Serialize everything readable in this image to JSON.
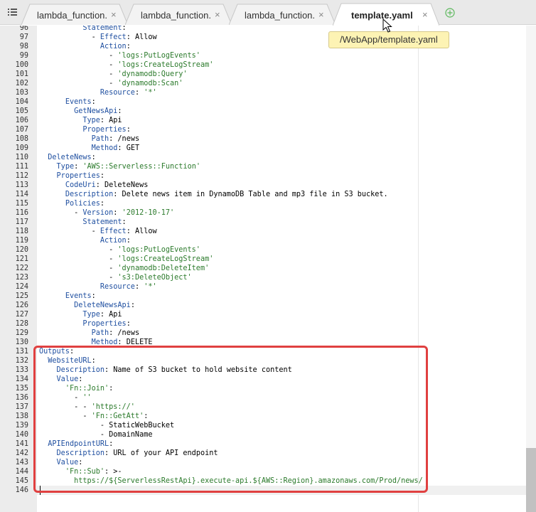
{
  "tabs": [
    {
      "label": "lambda_function.",
      "active": false
    },
    {
      "label": "lambda_function.",
      "active": false
    },
    {
      "label": "lambda_function.",
      "active": false
    },
    {
      "label": "template.yaml",
      "active": true
    }
  ],
  "tooltip": "/WebApp/template.yaml",
  "close_glyph": "×",
  "icons": {
    "menu": "tab-menu-icon",
    "add": "add-tab-icon",
    "pointer": "mouse-pointer-icon"
  },
  "editor": {
    "first_line_number": 96,
    "highlighted_lines": {
      "from": 131,
      "to": 145
    },
    "current_line": 146,
    "lines": [
      [
        [
          "p",
          "          "
        ],
        [
          "k",
          "Statement"
        ],
        [
          "p",
          ":"
        ]
      ],
      [
        [
          "p",
          "            - "
        ],
        [
          "k",
          "Effect"
        ],
        [
          "p",
          ": Allow"
        ]
      ],
      [
        [
          "p",
          "              "
        ],
        [
          "k",
          "Action"
        ],
        [
          "p",
          ":"
        ]
      ],
      [
        [
          "p",
          "                - "
        ],
        [
          "s",
          "'logs:PutLogEvents'"
        ]
      ],
      [
        [
          "p",
          "                - "
        ],
        [
          "s",
          "'logs:CreateLogStream'"
        ]
      ],
      [
        [
          "p",
          "                - "
        ],
        [
          "s",
          "'dynamodb:Query'"
        ]
      ],
      [
        [
          "p",
          "                - "
        ],
        [
          "s",
          "'dynamodb:Scan'"
        ]
      ],
      [
        [
          "p",
          "              "
        ],
        [
          "k",
          "Resource"
        ],
        [
          "p",
          ": "
        ],
        [
          "s",
          "'*'"
        ]
      ],
      [
        [
          "p",
          "      "
        ],
        [
          "k",
          "Events"
        ],
        [
          "p",
          ":"
        ]
      ],
      [
        [
          "p",
          "        "
        ],
        [
          "k",
          "GetNewsApi"
        ],
        [
          "p",
          ":"
        ]
      ],
      [
        [
          "p",
          "          "
        ],
        [
          "k",
          "Type"
        ],
        [
          "p",
          ": Api"
        ]
      ],
      [
        [
          "p",
          "          "
        ],
        [
          "k",
          "Properties"
        ],
        [
          "p",
          ":"
        ]
      ],
      [
        [
          "p",
          "            "
        ],
        [
          "k",
          "Path"
        ],
        [
          "p",
          ": /news"
        ]
      ],
      [
        [
          "p",
          "            "
        ],
        [
          "k",
          "Method"
        ],
        [
          "p",
          ": GET"
        ]
      ],
      [
        [
          "p",
          "  "
        ],
        [
          "k",
          "DeleteNews"
        ],
        [
          "p",
          ":"
        ]
      ],
      [
        [
          "p",
          "    "
        ],
        [
          "k",
          "Type"
        ],
        [
          "p",
          ": "
        ],
        [
          "s",
          "'AWS::Serverless::Function'"
        ]
      ],
      [
        [
          "p",
          "    "
        ],
        [
          "k",
          "Properties"
        ],
        [
          "p",
          ":"
        ]
      ],
      [
        [
          "p",
          "      "
        ],
        [
          "k",
          "CodeUri"
        ],
        [
          "p",
          ": DeleteNews"
        ]
      ],
      [
        [
          "p",
          "      "
        ],
        [
          "k",
          "Description"
        ],
        [
          "p",
          ": Delete news item in DynamoDB Table and mp3 file in S3 bucket."
        ]
      ],
      [
        [
          "p",
          "      "
        ],
        [
          "k",
          "Policies"
        ],
        [
          "p",
          ":"
        ]
      ],
      [
        [
          "p",
          "        - "
        ],
        [
          "k",
          "Version"
        ],
        [
          "p",
          ": "
        ],
        [
          "s",
          "'2012-10-17'"
        ]
      ],
      [
        [
          "p",
          "          "
        ],
        [
          "k",
          "Statement"
        ],
        [
          "p",
          ":"
        ]
      ],
      [
        [
          "p",
          "            - "
        ],
        [
          "k",
          "Effect"
        ],
        [
          "p",
          ": Allow"
        ]
      ],
      [
        [
          "p",
          "              "
        ],
        [
          "k",
          "Action"
        ],
        [
          "p",
          ":"
        ]
      ],
      [
        [
          "p",
          "                - "
        ],
        [
          "s",
          "'logs:PutLogEvents'"
        ]
      ],
      [
        [
          "p",
          "                - "
        ],
        [
          "s",
          "'logs:CreateLogStream'"
        ]
      ],
      [
        [
          "p",
          "                - "
        ],
        [
          "s",
          "'dynamodb:DeleteItem'"
        ]
      ],
      [
        [
          "p",
          "                - "
        ],
        [
          "s",
          "'s3:DeleteObject'"
        ]
      ],
      [
        [
          "p",
          "              "
        ],
        [
          "k",
          "Resource"
        ],
        [
          "p",
          ": "
        ],
        [
          "s",
          "'*'"
        ]
      ],
      [
        [
          "p",
          "      "
        ],
        [
          "k",
          "Events"
        ],
        [
          "p",
          ":"
        ]
      ],
      [
        [
          "p",
          "        "
        ],
        [
          "k",
          "DeleteNewsApi"
        ],
        [
          "p",
          ":"
        ]
      ],
      [
        [
          "p",
          "          "
        ],
        [
          "k",
          "Type"
        ],
        [
          "p",
          ": Api"
        ]
      ],
      [
        [
          "p",
          "          "
        ],
        [
          "k",
          "Properties"
        ],
        [
          "p",
          ":"
        ]
      ],
      [
        [
          "p",
          "            "
        ],
        [
          "k",
          "Path"
        ],
        [
          "p",
          ": /news"
        ]
      ],
      [
        [
          "p",
          "            "
        ],
        [
          "k",
          "Method"
        ],
        [
          "p",
          ": DELETE"
        ]
      ],
      [
        [
          "k",
          "Outputs"
        ],
        [
          "p",
          ":"
        ]
      ],
      [
        [
          "p",
          "  "
        ],
        [
          "k",
          "WebsiteURL"
        ],
        [
          "p",
          ":"
        ]
      ],
      [
        [
          "p",
          "    "
        ],
        [
          "k",
          "Description"
        ],
        [
          "p",
          ": Name of S3 bucket to hold website content"
        ]
      ],
      [
        [
          "p",
          "    "
        ],
        [
          "k",
          "Value"
        ],
        [
          "p",
          ":"
        ]
      ],
      [
        [
          "p",
          "      "
        ],
        [
          "s",
          "'Fn::Join'"
        ],
        [
          "p",
          ":"
        ]
      ],
      [
        [
          "p",
          "        - "
        ],
        [
          "s",
          "''"
        ]
      ],
      [
        [
          "p",
          "        - - "
        ],
        [
          "s",
          "'https://'"
        ]
      ],
      [
        [
          "p",
          "          - "
        ],
        [
          "s",
          "'Fn::GetAtt'"
        ],
        [
          "p",
          ":"
        ]
      ],
      [
        [
          "p",
          "              - StaticWebBucket"
        ]
      ],
      [
        [
          "p",
          "              - DomainName"
        ]
      ],
      [
        [
          "p",
          "  "
        ],
        [
          "k",
          "APIEndpointURL"
        ],
        [
          "p",
          ":"
        ]
      ],
      [
        [
          "p",
          "    "
        ],
        [
          "k",
          "Description"
        ],
        [
          "p",
          ": URL of your API endpoint"
        ]
      ],
      [
        [
          "p",
          "    "
        ],
        [
          "k",
          "Value"
        ],
        [
          "p",
          ":"
        ]
      ],
      [
        [
          "p",
          "      "
        ],
        [
          "s",
          "'Fn::Sub'"
        ],
        [
          "p",
          ": >-"
        ]
      ],
      [
        [
          "p",
          "        "
        ],
        [
          "s",
          "https://${ServerlessRestApi}.execute-api.${AWS::Region}.amazonaws.com/Prod/news/"
        ]
      ],
      []
    ]
  },
  "colors": {
    "highlight": "#e04040",
    "key": "#1f4fa0",
    "string": "#2b7a2b",
    "tooltip_bg": "#fdf3b4"
  }
}
